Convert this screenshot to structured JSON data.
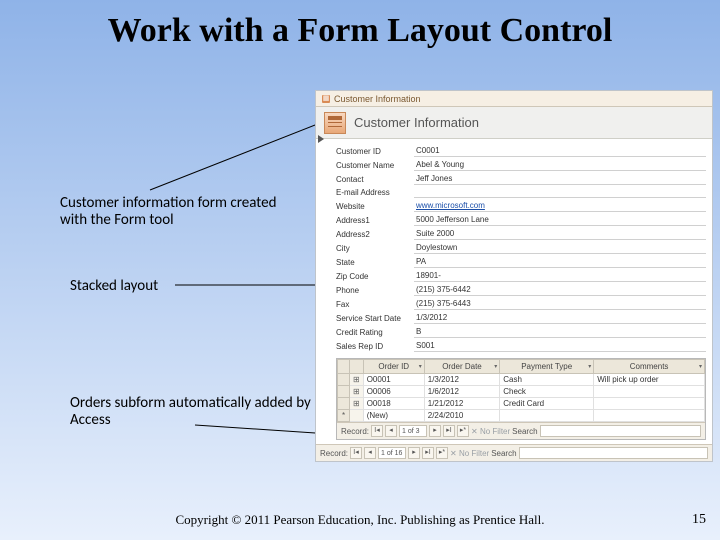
{
  "slide": {
    "title": "Work with a Form Layout Control",
    "copyright": "Copyright © 2011 Pearson Education, Inc. Publishing as Prentice Hall.",
    "number": "15"
  },
  "callouts": {
    "c1": "Customer information form created with the Form tool",
    "c2": "Stacked layout",
    "c3": "Orders subform automatically added by Access"
  },
  "access": {
    "tab_title": "Customer Information",
    "form_title": "Customer Information",
    "fields": [
      {
        "label": "Customer ID",
        "value": "C0001"
      },
      {
        "label": "Customer Name",
        "value": "Abel & Young"
      },
      {
        "label": "Contact",
        "value": "Jeff Jones"
      },
      {
        "label": "E-mail Address",
        "value": ""
      },
      {
        "label": "Website",
        "value": "www.microsoft.com",
        "link": true
      },
      {
        "label": "Address1",
        "value": "5000 Jefferson Lane"
      },
      {
        "label": "Address2",
        "value": "Suite 2000"
      },
      {
        "label": "City",
        "value": "Doylestown"
      },
      {
        "label": "State",
        "value": "PA"
      },
      {
        "label": "Zip Code",
        "value": "18901-"
      },
      {
        "label": "Phone",
        "value": "(215) 375-6442"
      },
      {
        "label": "Fax",
        "value": "(215) 375-6443"
      },
      {
        "label": "Service Start Date",
        "value": "1/3/2012"
      },
      {
        "label": "Credit Rating",
        "value": "B"
      },
      {
        "label": "Sales Rep ID",
        "value": "S001"
      }
    ],
    "subform": {
      "columns": [
        "Order ID",
        "Order Date",
        "Payment Type",
        "Comments"
      ],
      "rows": [
        {
          "expand": "E",
          "cells": [
            "O0001",
            "1/3/2012",
            "Cash",
            "Will pick up order"
          ]
        },
        {
          "expand": "E",
          "cells": [
            "O0006",
            "1/6/2012",
            "Check",
            ""
          ]
        },
        {
          "expand": "E",
          "cells": [
            "O0018",
            "1/21/2012",
            "Credit Card",
            ""
          ]
        },
        {
          "expand": "*",
          "new": true,
          "cells": [
            "(New)",
            "2/24/2010",
            "",
            ""
          ]
        }
      ],
      "nav": {
        "label": "Record:",
        "pos": "1 of 3",
        "nofilter": "No Filter",
        "search": "Search"
      }
    },
    "outer_nav": {
      "label": "Record:",
      "pos": "1 of 16",
      "nofilter": "No Filter",
      "search": "Search"
    }
  }
}
